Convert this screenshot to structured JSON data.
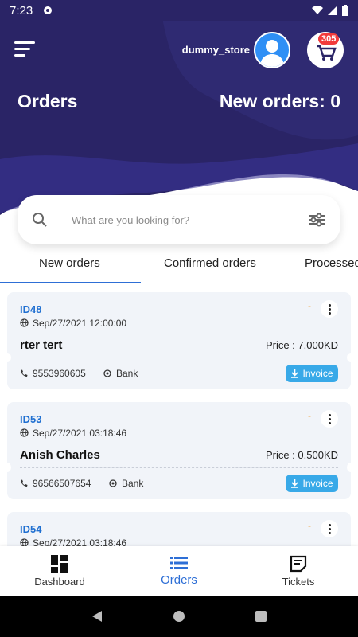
{
  "status_bar": {
    "time": "7:23",
    "icons": [
      "gear-icon",
      "wifi-icon",
      "signal-icon",
      "battery-icon"
    ]
  },
  "header": {
    "store_name": "dummy_store",
    "cart_badge": "305",
    "title": "Orders",
    "new_orders_label": "New orders: 0",
    "colors": {
      "header_bg": "#2a2466",
      "accent": "#2e6fd6"
    }
  },
  "search": {
    "placeholder": "What are you looking for?"
  },
  "tabs": [
    {
      "label": "New orders",
      "active": true
    },
    {
      "label": "Confirmed orders",
      "active": false
    },
    {
      "label": "Processed",
      "active": false
    }
  ],
  "orders": [
    {
      "id": "ID48",
      "date": "Sep/27/2021 12:00:00",
      "marker": "-",
      "customer": "rter tert",
      "price": "Price : 7.000KD",
      "phone": "9553960605",
      "payment": "Bank",
      "invoice_label": "Invoice"
    },
    {
      "id": "ID53",
      "date": "Sep/27/2021 03:18:46",
      "marker": "-",
      "customer": "Anish Charles",
      "price": "Price : 0.500KD",
      "phone": "96566507654",
      "payment": "Bank",
      "invoice_label": "Invoice"
    },
    {
      "id": "ID54",
      "date": "Sep/27/2021 03:18:46",
      "marker": "-"
    }
  ],
  "bottom_nav": [
    {
      "label": "Dashboard",
      "icon": "dashboard-icon",
      "active": false
    },
    {
      "label": "Orders",
      "icon": "list-icon",
      "active": true
    },
    {
      "label": "Tickets",
      "icon": "ticket-icon",
      "active": false
    }
  ]
}
